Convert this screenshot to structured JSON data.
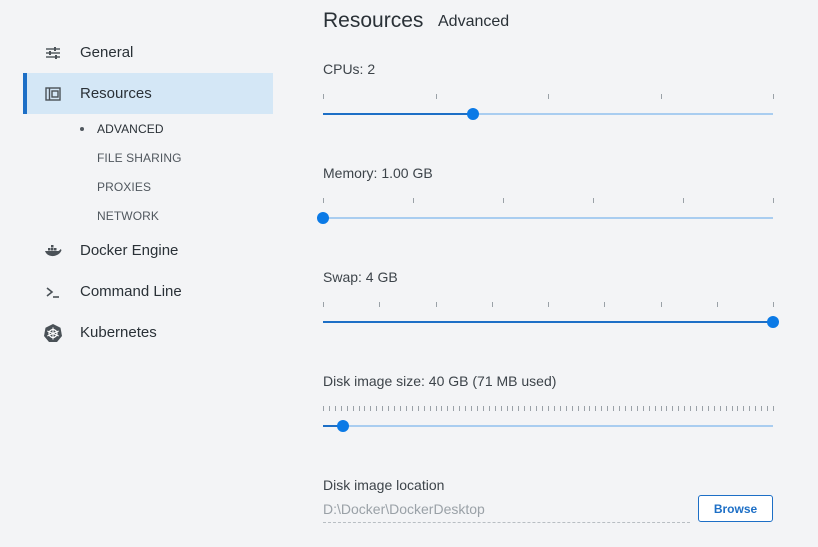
{
  "sidebar": {
    "items": [
      {
        "label": "General",
        "icon": "sliders-icon"
      },
      {
        "label": "Resources",
        "icon": "resources-icon"
      },
      {
        "label": "Docker Engine",
        "icon": "whale-icon"
      },
      {
        "label": "Command Line",
        "icon": "terminal-icon"
      },
      {
        "label": "Kubernetes",
        "icon": "kubernetes-icon"
      }
    ],
    "sub_items": [
      "ADVANCED",
      "FILE SHARING",
      "PROXIES",
      "NETWORK"
    ]
  },
  "header": {
    "title": "Resources",
    "subtitle": "Advanced"
  },
  "settings": {
    "cpus": {
      "label": "CPUs: 2",
      "value": 2,
      "min": 0,
      "max": 6
    },
    "memory": {
      "label": "Memory: 1.00 GB",
      "value": 1,
      "min": 1,
      "max": 5
    },
    "swap": {
      "label": "Swap: 4 GB",
      "value": 4,
      "min": 0,
      "max": 4
    },
    "disk": {
      "label": "Disk image size: 40 GB (71 MB used)",
      "fraction": 0.044
    },
    "location": {
      "label": "Disk image location",
      "value": "D:\\Docker\\DockerDesktop",
      "button": "Browse"
    }
  },
  "colors": {
    "accent": "#1d6fc6",
    "active_bg": "#d4e7f6",
    "track": "#a9cdf0"
  }
}
